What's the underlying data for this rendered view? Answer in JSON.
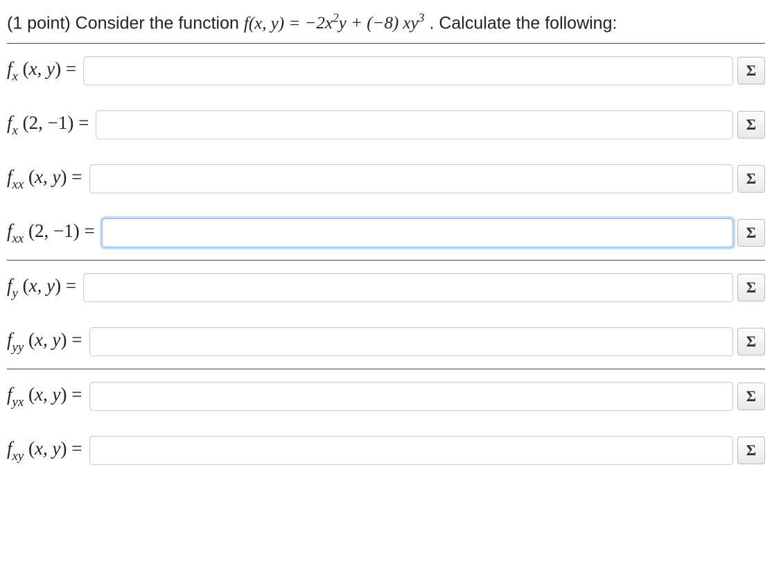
{
  "prompt": {
    "points_prefix": "(1 point) Consider the function ",
    "func_lhs": "f(x, y) = ",
    "func_rhs_html": "−2x²y + (−8) xy³",
    "suffix": " . Calculate the following:"
  },
  "sigma": "Σ",
  "rows": [
    {
      "label_html": "f<sub class='sub'>x</sub> <span class='paren'>(</span>x, y<span class='paren'>)</span> <span class='eq'>=</span>",
      "ruled": false,
      "focused": false,
      "name": "fx-xy"
    },
    {
      "label_html": "f<sub class='sub'>x</sub> <span class='paren'>(2, −1)</span> <span class='eq'>=</span>",
      "ruled": false,
      "focused": false,
      "name": "fx-2-neg1"
    },
    {
      "label_html": "f<sub class='sub'>xx</sub> <span class='paren'>(</span>x, y<span class='paren'>)</span> <span class='eq'>=</span>",
      "ruled": false,
      "focused": false,
      "name": "fxx-xy"
    },
    {
      "label_html": "f<sub class='sub'>xx</sub> <span class='paren'>(2, −1)</span> <span class='eq'>=</span>",
      "ruled": true,
      "focused": true,
      "name": "fxx-2-neg1"
    },
    {
      "label_html": "f<sub class='sub'>y</sub> <span class='paren'>(</span>x, y<span class='paren'>)</span> <span class='eq'>=</span>",
      "ruled": false,
      "focused": false,
      "name": "fy-xy"
    },
    {
      "label_html": "f<sub class='sub'>yy</sub> <span class='paren'>(</span>x, y<span class='paren'>)</span> <span class='eq'>=</span>",
      "ruled": true,
      "focused": false,
      "name": "fyy-xy"
    },
    {
      "label_html": "f<sub class='sub'>yx</sub> <span class='paren'>(</span>x, y<span class='paren'>)</span> <span class='eq'>=</span>",
      "ruled": false,
      "focused": false,
      "name": "fyx-xy"
    },
    {
      "label_html": "f<sub class='sub'>xy</sub> <span class='paren'>(</span>x, y<span class='paren'>)</span> <span class='eq'>=</span>",
      "ruled": false,
      "focused": false,
      "name": "fxy-xy"
    }
  ]
}
